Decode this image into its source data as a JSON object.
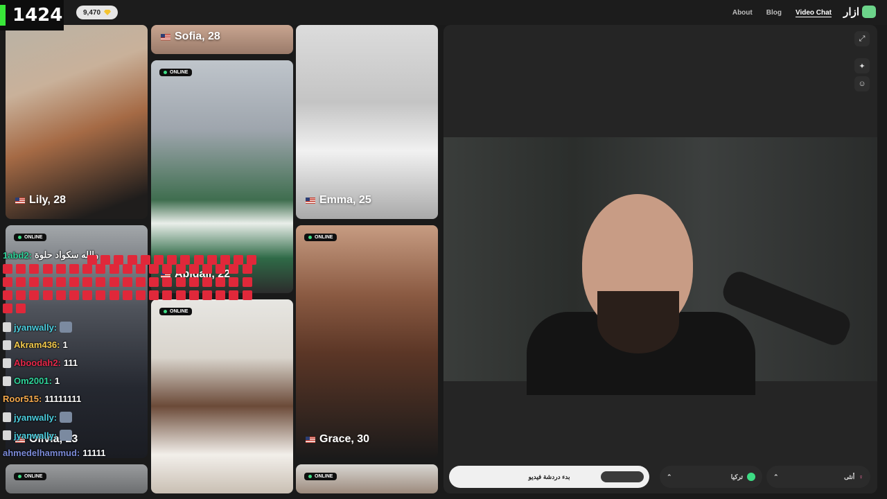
{
  "stream": {
    "viewer_count": "1424"
  },
  "header": {
    "coins": "9,470",
    "nav": [
      "About",
      "Blog",
      "Video Chat"
    ],
    "brand": "ازار"
  },
  "profiles": [
    {
      "name": "Sofia, 28"
    },
    {
      "name": "Lily, 28"
    },
    {
      "name": "Emma, 25"
    },
    {
      "name": "Abigail, 22",
      "online": "ONLINE"
    },
    {
      "name": "Olivia, 23",
      "online": "ONLINE"
    },
    {
      "name": "Grace, 30",
      "online": "ONLINE"
    },
    {
      "online": "ONLINE"
    },
    {
      "online": "ONLINE"
    },
    {
      "online": "ONLINE"
    }
  ],
  "panel": {
    "start_button": "بدء دردشة فيديو",
    "country": "تركيا",
    "gender": "أنثى"
  },
  "chat": [
    {
      "user": "1abd2:",
      "text": "والله سكواد حلوة",
      "color": "#2fd39a"
    },
    {
      "user": "jyanwally:",
      "text": "",
      "color": "#4ccfe0"
    },
    {
      "user": "Akram436:",
      "text": "1",
      "color": "#f2c94c"
    },
    {
      "user": "Aboodah2:",
      "text": "111",
      "color": "#e8294b"
    },
    {
      "user": "Om2001:",
      "text": "1",
      "color": "#2fd39a"
    },
    {
      "user": "Roor515:",
      "text": "11111111",
      "color": "#f5a94c"
    },
    {
      "user": "jyanwally:",
      "text": "",
      "color": "#4ccfe0"
    },
    {
      "user": "jyanwally:",
      "text": "",
      "color": "#4ccfe0"
    },
    {
      "user": "ahmedelhammud:",
      "text": "11111",
      "color": "#7b8ad8"
    }
  ],
  "colors": {
    "online_dot": "#3ddc84",
    "spam_emote": "#e0283a",
    "accent_green": "#6cd48a"
  }
}
